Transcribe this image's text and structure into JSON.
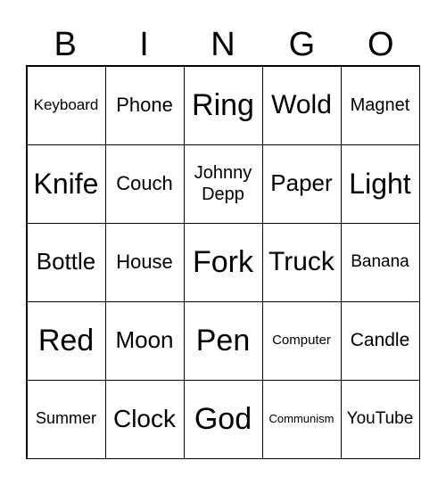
{
  "header": [
    "B",
    "I",
    "N",
    "G",
    "O"
  ],
  "cells": [
    [
      "Keyboard",
      "Phone",
      "Ring",
      "Wold",
      "Magnet"
    ],
    [
      "Knife",
      "Couch",
      "Johnny Depp",
      "Paper",
      "Light"
    ],
    [
      "Bottle",
      "House",
      "Fork",
      "Truck",
      "Banana"
    ],
    [
      "Red",
      "Moon",
      "Pen",
      "Computer",
      "Candle"
    ],
    [
      "Summer",
      "Clock",
      "God",
      "Communism",
      "YouTube"
    ]
  ]
}
